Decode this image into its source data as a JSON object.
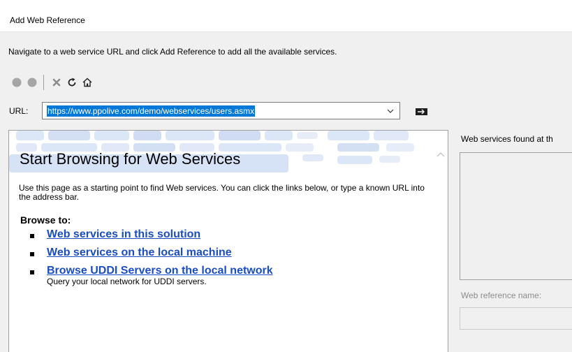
{
  "window": {
    "title": "Add Web Reference"
  },
  "instruction": "Navigate to a web service URL and click Add Reference to add all the available services.",
  "toolbar": {
    "icons": [
      "back-icon",
      "forward-icon",
      "stop-icon",
      "refresh-icon",
      "home-icon"
    ]
  },
  "url": {
    "label": "URL:",
    "value": "https://www.ppolive.com/demo/webservices/users.asmx"
  },
  "browser": {
    "heading": "Start Browsing for Web Services",
    "description": "Use this page as a starting point to find Web services. You can click the links below, or type a known URL into the address bar.",
    "browse_to": "Browse to:",
    "links": [
      {
        "label": "Web services in this solution",
        "sub": ""
      },
      {
        "label": "Web services on the local machine",
        "sub": ""
      },
      {
        "label": "Browse UDDI Servers on the local network",
        "sub": "Query your local network for UDDI servers."
      }
    ]
  },
  "right_panel": {
    "found_label": "Web services found at th",
    "ref_name_label": "Web reference name:"
  },
  "colors": {
    "selection": "#0078d7",
    "link": "#1a4dbf",
    "banner_tile": "#dbe6f7"
  }
}
